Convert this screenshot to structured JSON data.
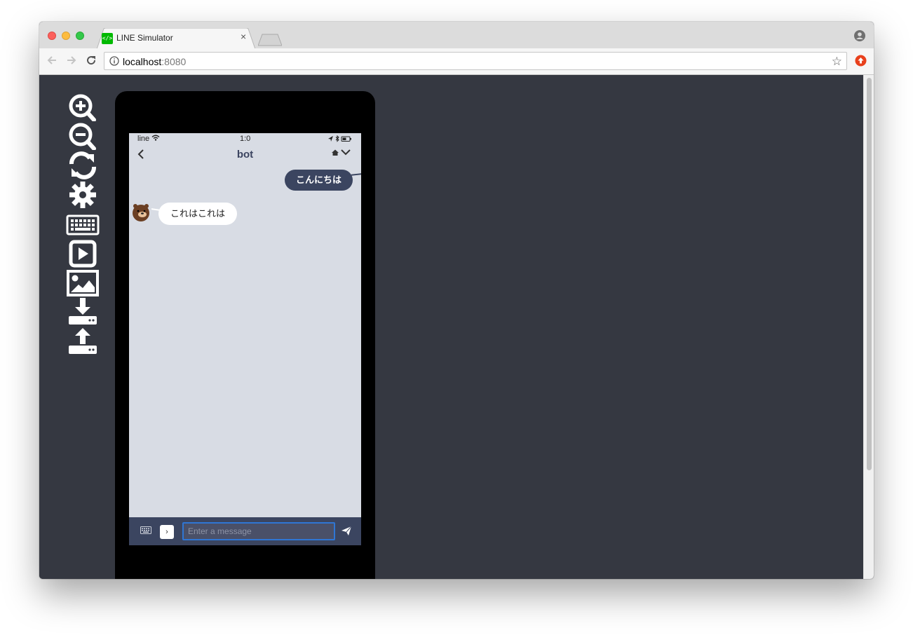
{
  "browser": {
    "tab_title": "LINE Simulator",
    "favicon_text": "</>",
    "url_host": "localhost",
    "url_port": ":8080",
    "close_tab": "×",
    "bookmark_star": "☆"
  },
  "toolbar_tools": [
    {
      "name": "zoom-in-icon"
    },
    {
      "name": "zoom-out-icon"
    },
    {
      "name": "refresh-icon"
    },
    {
      "name": "settings-icon"
    },
    {
      "name": "keyboard-icon"
    },
    {
      "name": "play-video-icon"
    },
    {
      "name": "image-icon"
    },
    {
      "name": "download-icon"
    },
    {
      "name": "upload-icon"
    }
  ],
  "phone": {
    "status": {
      "carrier": "line",
      "time": "1:0"
    },
    "chat": {
      "title": "bot",
      "messages": [
        {
          "direction": "out",
          "text": "こんにちは"
        },
        {
          "direction": "in",
          "text": "これはこれは"
        }
      ]
    },
    "input": {
      "placeholder": "Enter a message",
      "chevron": "›"
    }
  },
  "colors": {
    "app_background": "#353841",
    "chat_background": "#d8dce4",
    "outgoing_bubble": "#3b4560",
    "input_focus": "#2f76d4",
    "line_green": "#00b900"
  }
}
